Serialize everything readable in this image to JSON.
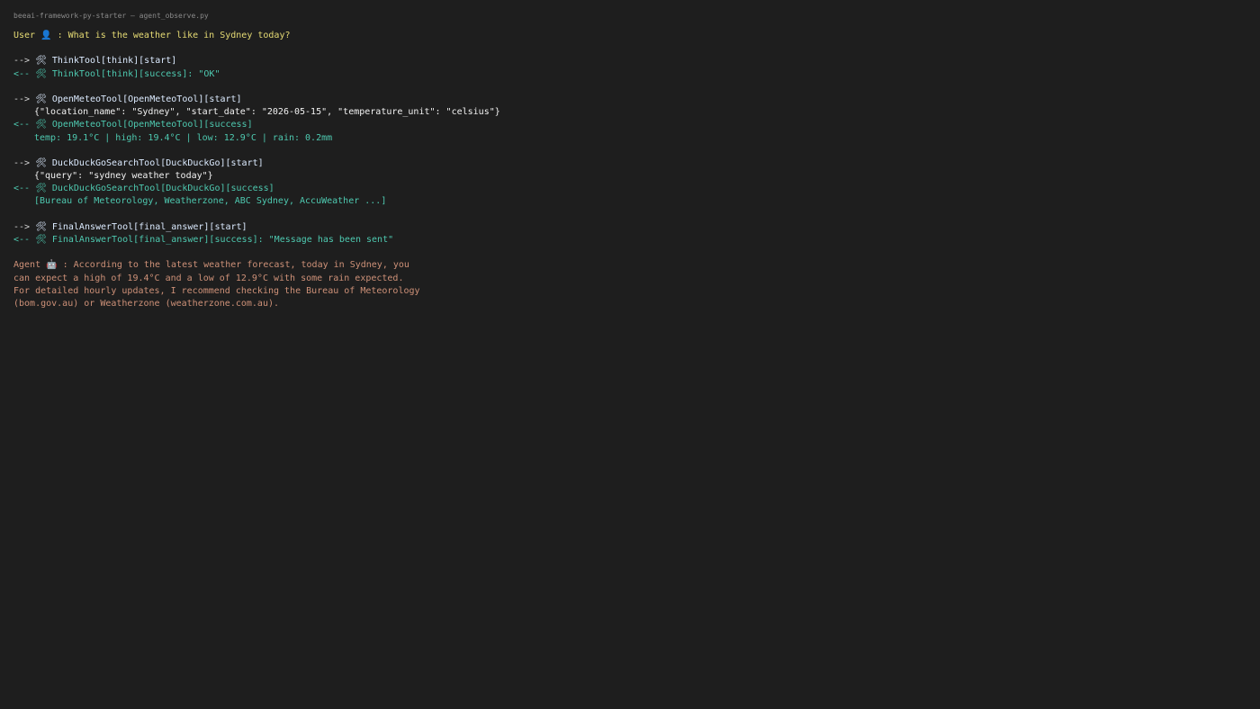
{
  "window": {
    "title": "beeai-framework-py-starter — agent_observe.py"
  },
  "icons": {
    "user": "👤",
    "tool": "🛠",
    "agent": "🤖"
  },
  "colors": {
    "background": "#1e1e1e",
    "user_text": "#e6db74",
    "tool_call": "#dcebff",
    "tool_success": "#4ec9b0",
    "agent_text": "#ce9178"
  },
  "user": {
    "prefix": "User",
    "sep": " : ",
    "message": "What is the weather like in Sydney today?"
  },
  "arrows": {
    "out": "-->",
    "in": "<--"
  },
  "events": {
    "think_start": "ThinkTool[think][start]",
    "think_success": "ThinkTool[think][success]: \"OK\"",
    "meteo_start": "OpenMeteoTool[OpenMeteoTool][start]",
    "meteo_input": "{\"location_name\": \"Sydney\", \"start_date\": \"2026-05-15\", \"temperature_unit\": \"celsius\"}",
    "meteo_success": "OpenMeteoTool[OpenMeteoTool][success]",
    "meteo_output": "temp: 19.1°C | high: 19.4°C | low: 12.9°C | rain: 0.2mm",
    "ddg_start": "DuckDuckGoSearchTool[DuckDuckGo][start]",
    "ddg_input": "{\"query\": \"sydney weather today\"}",
    "ddg_success": "DuckDuckGoSearchTool[DuckDuckGo][success]",
    "ddg_output": "[Bureau of Meteorology, Weatherzone, ABC Sydney, AccuWeather ...]",
    "final_start": "FinalAnswerTool[final_answer][start]",
    "final_success": "FinalAnswerTool[final_answer][success]: \"Message has been sent\""
  },
  "agent": {
    "prefix": "Agent",
    "sep": " : ",
    "line1": "According to the latest weather forecast, today in Sydney, you",
    "line2": "can expect a high of 19.4°C and a low of 12.9°C with some rain expected.",
    "line3": "For detailed hourly updates, I recommend checking the Bureau of Meteorology",
    "line4": "(bom.gov.au) or Weatherzone (weatherzone.com.au)."
  }
}
